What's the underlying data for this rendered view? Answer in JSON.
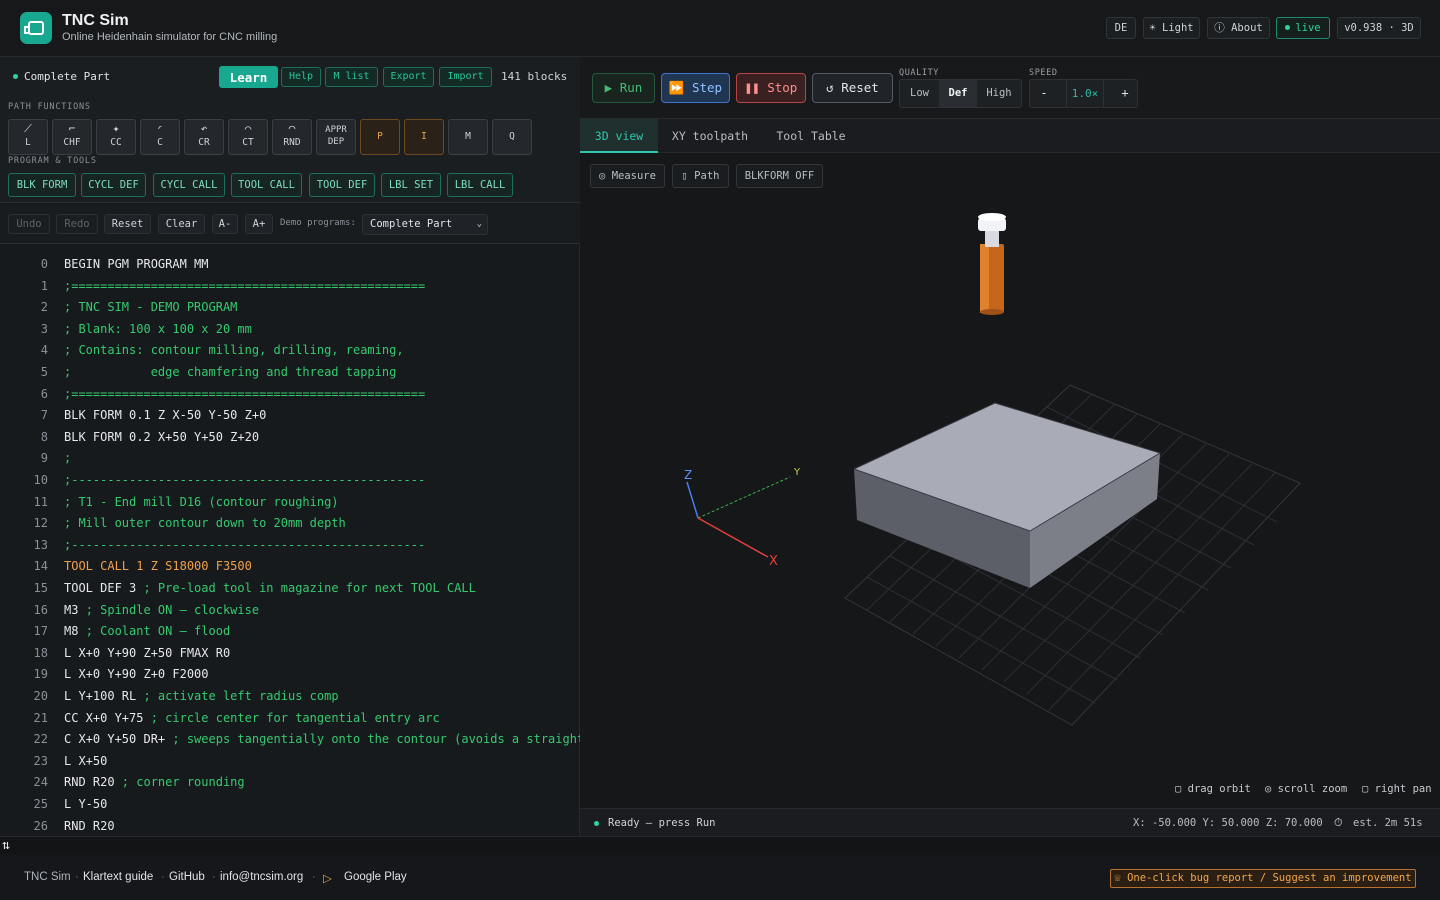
{
  "header": {
    "title": "TNC Sim",
    "subtitle": "Online Heidenhain simulator for CNC milling",
    "lang_button": "DE",
    "theme_button": "☀ Light",
    "about_button": "About",
    "live_badge": "live",
    "version": "v0.938 · 3D",
    "accent_color": "#17a88f"
  },
  "left": {
    "program_name": "Complete Part",
    "toolbar": {
      "learn": "Learn",
      "help": "Help",
      "mlist": "M list",
      "export": "Export",
      "import": "Import",
      "blocks": "141 blocks"
    },
    "path_functions_label": "PATH FUNCTIONS",
    "path_functions": [
      {
        "label": "L",
        "icon": "line-icon"
      },
      {
        "label": "CHF",
        "icon": "chamfer-icon"
      },
      {
        "label": "CC",
        "icon": "circle-center-icon"
      },
      {
        "label": "C",
        "icon": "arc-icon"
      },
      {
        "label": "CR",
        "icon": "arc-radius-icon"
      },
      {
        "label": "CT",
        "icon": "tangent-arc-icon"
      },
      {
        "label": "RND",
        "icon": "rounding-icon"
      },
      {
        "label": "APPR\nDEP"
      },
      {
        "label": "P"
      },
      {
        "label": "I"
      },
      {
        "label": "M"
      },
      {
        "label": "Q"
      }
    ],
    "program_tools_label": "PROGRAM & TOOLS",
    "program_tools": [
      "BLK FORM",
      "CYCL DEF",
      "CYCL CALL",
      "TOOL CALL",
      "TOOL DEF",
      "LBL SET",
      "LBL CALL"
    ],
    "editor": {
      "undo": "Undo",
      "redo": "Redo",
      "reset": "Reset",
      "clear": "Clear",
      "font_smaller": "A-",
      "font_larger": "A+",
      "demo_label": "Demo programs:",
      "demo_selected": "Complete Part"
    },
    "code_lines": [
      {
        "n": "0",
        "text": "BEGIN PGM PROGRAM MM",
        "cls": "c-code"
      },
      {
        "n": "1",
        "text": ";=================================================",
        "cls": "c-comment"
      },
      {
        "n": "2",
        "text": "; TNC SIM - DEMO PROGRAM",
        "cls": "c-comment"
      },
      {
        "n": "3",
        "text": "; Blank: 100 x 100 x 20 mm",
        "cls": "c-comment"
      },
      {
        "n": "4",
        "text": "; Contains: contour milling, drilling, reaming,",
        "cls": "c-comment"
      },
      {
        "n": "5",
        "text": ";           edge chamfering and thread tapping",
        "cls": "c-comment"
      },
      {
        "n": "6",
        "text": ";=================================================",
        "cls": "c-comment"
      },
      {
        "n": "7",
        "text": "BLK FORM 0.1 Z X-50 Y-50 Z+0",
        "cls": "c-code"
      },
      {
        "n": "8",
        "text": "BLK FORM 0.2 X+50 Y+50 Z+20",
        "cls": "c-code"
      },
      {
        "n": "9",
        "text": ";",
        "cls": "c-comment"
      },
      {
        "n": "10",
        "text": ";-------------------------------------------------",
        "cls": "c-comment"
      },
      {
        "n": "11",
        "text": "; T1 - End mill D16 (contour roughing)",
        "cls": "c-comment"
      },
      {
        "n": "12",
        "text": "; Mill outer contour down to 20mm depth",
        "cls": "c-comment"
      },
      {
        "n": "13",
        "text": ";-------------------------------------------------",
        "cls": "c-comment"
      },
      {
        "n": "14",
        "text": "TOOL CALL 1 Z S18000 F3500",
        "cls": "c-tool"
      },
      {
        "n": "15",
        "code": "TOOL DEF 3 ",
        "comment": "; Pre-load tool in magazine for next TOOL CALL"
      },
      {
        "n": "16",
        "code": "M3 ",
        "comment": "; Spindle ON — clockwise"
      },
      {
        "n": "17",
        "code": "M8 ",
        "comment": "; Coolant ON — flood"
      },
      {
        "n": "18",
        "text": "L X+0 Y+90 Z+50 FMAX R0",
        "cls": "c-code"
      },
      {
        "n": "19",
        "text": "L X+0 Y+90 Z+0 F2000",
        "cls": "c-code"
      },
      {
        "n": "20",
        "code": "L Y+100 RL ",
        "comment": "; activate left radius comp"
      },
      {
        "n": "21",
        "code": "CC X+0 Y+75 ",
        "comment": "; circle center for tangential entry arc"
      },
      {
        "n": "22",
        "code": "C X+0 Y+50 DR+ ",
        "comment": "; sweeps tangentially onto the contour (avoids a straight"
      },
      {
        "n": "23",
        "text": "L X+50",
        "cls": "c-code"
      },
      {
        "n": "24",
        "code": "RND R20 ",
        "comment": "; corner rounding"
      },
      {
        "n": "25",
        "text": "L Y-50",
        "cls": "c-code"
      },
      {
        "n": "26",
        "text": "RND R20",
        "cls": "c-code"
      }
    ]
  },
  "right": {
    "run": "Run",
    "step": "Step",
    "stop": "Stop",
    "reset": "Reset",
    "quality_label": "QUALITY",
    "quality_options": [
      "Low",
      "Def",
      "High"
    ],
    "quality_selected": "Def",
    "speed_label": "SPEED",
    "speed_minus": "-",
    "speed_value": "1.0×",
    "speed_plus": "+",
    "tabs": [
      "3D view",
      "XY toolpath",
      "Tool Table"
    ],
    "active_tab": "3D view",
    "view_buttons": {
      "measure": "◎ Measure",
      "path": "▯ Path",
      "blkform": "BLKFORM OFF"
    },
    "axes": {
      "x": "X",
      "y": "Y",
      "z": "Z"
    },
    "hints": {
      "orbit": "▢ drag orbit",
      "zoom": "◎ scroll zoom",
      "pan": "▢ right pan"
    },
    "status": {
      "text": "Ready — press Run",
      "coords": "X: -50.000 Y: 50.000 Z: 70.000",
      "estimate": "est. 2m 51s"
    }
  },
  "footer": {
    "brand": "TNC Sim",
    "links": [
      "Klartext guide",
      "GitHub",
      "info@tncsim.org"
    ],
    "google_play": "Google Play",
    "bug_report": "One-click bug report / Suggest an improvement"
  }
}
